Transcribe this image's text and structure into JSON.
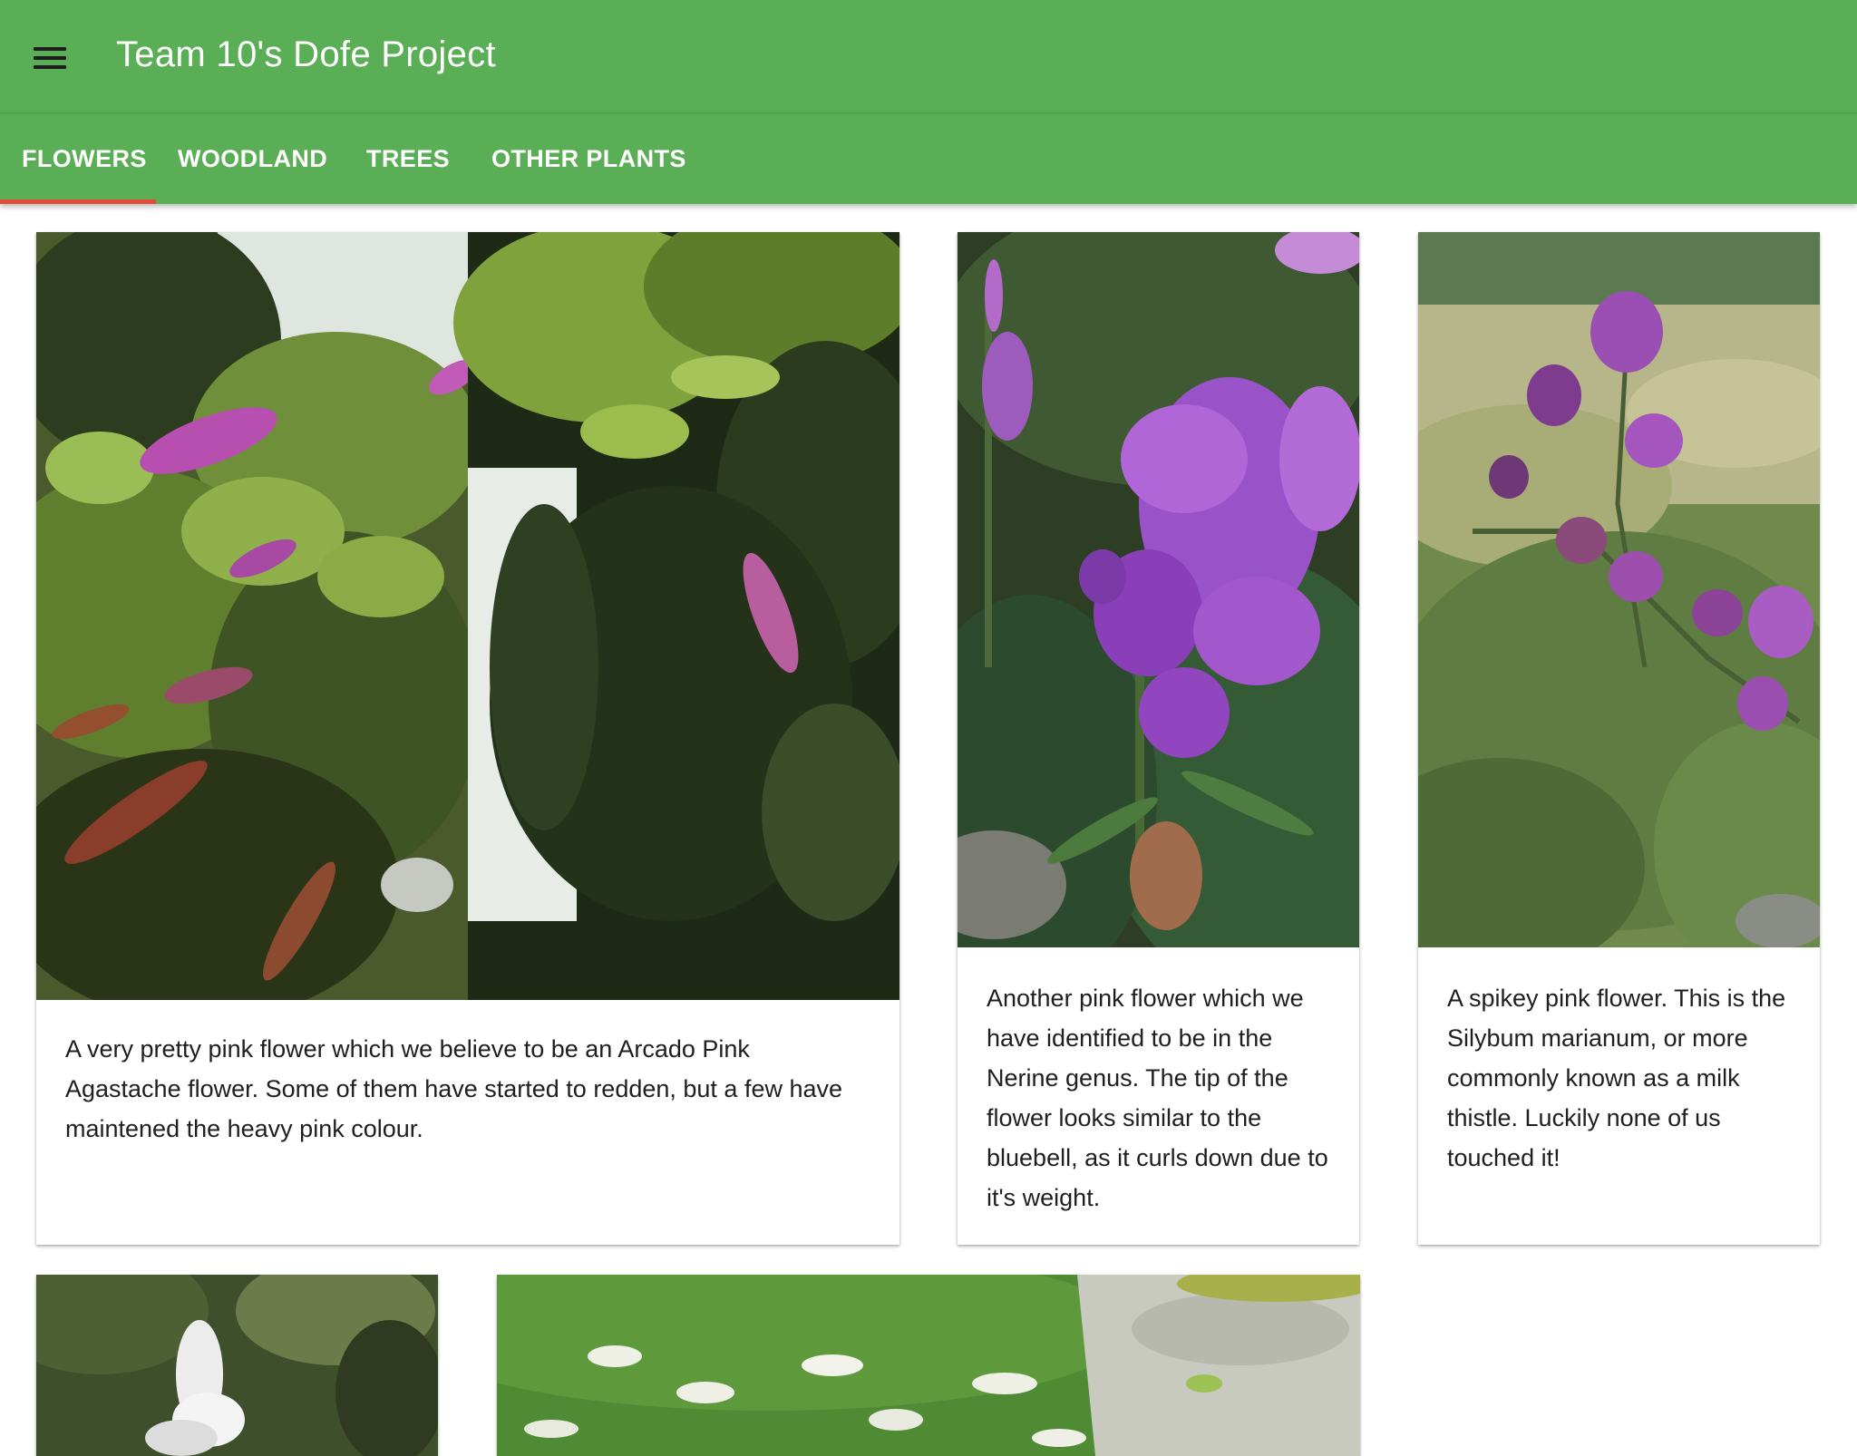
{
  "app": {
    "title": "Team 10's Dofe Project",
    "menu_icon": "hamburger-menu-icon"
  },
  "tabs": [
    {
      "label": "FLOWERS",
      "active": true
    },
    {
      "label": "WOODLAND",
      "active": false
    },
    {
      "label": "TREES",
      "active": false
    },
    {
      "label": "OTHER PLANTS",
      "active": false
    }
  ],
  "colors": {
    "app_bar": "#5aae55",
    "tab_indicator": "#e04b3b",
    "text": "#1f1f1f"
  },
  "cards": [
    {
      "description": "A very pretty pink flower which we believe to be an Arcado Pink Agastache flower. Some of them have started to redden, but a few have maintened the heavy pink colour."
    },
    {
      "description": "Another pink flower which we have identified to be in the Nerine genus. The tip of the flower looks similar to the bluebell, as it curls down due to it's weight."
    },
    {
      "description": "A spikey pink flower. This is the Silybum marianum, or more commonly known as a milk thistle. Luckily none of us touched it!"
    },
    {
      "description": ""
    },
    {
      "description": ""
    }
  ]
}
